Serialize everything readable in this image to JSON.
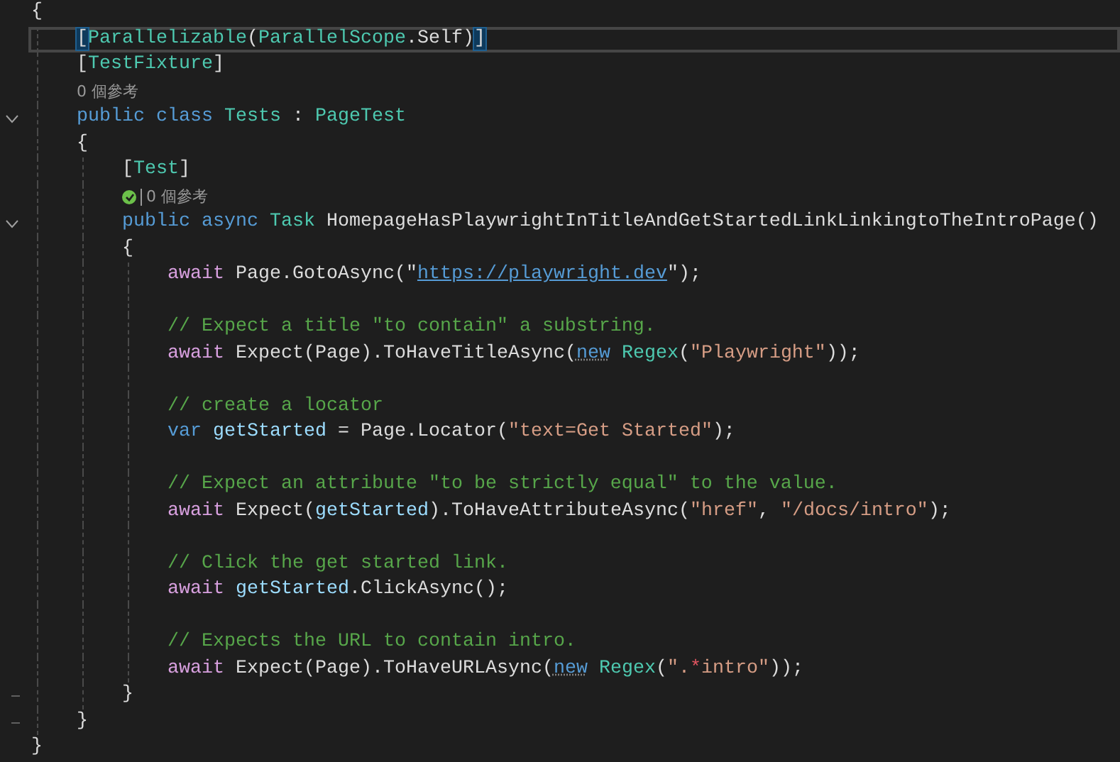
{
  "lines": [
    {
      "kind": "code",
      "tokens": [
        {
          "text": "{",
          "kind": "plain"
        }
      ],
      "children": [
        {
          "kind": "code",
          "current": true,
          "tokens": [
            {
              "text": "[",
              "kind": "plain",
              "match": true
            },
            {
              "text": "Parallelizable",
              "kind": "type"
            },
            {
              "text": "(",
              "kind": "plain"
            },
            {
              "text": "ParallelScope",
              "kind": "type"
            },
            {
              "text": ".Self)",
              "kind": "plain"
            },
            {
              "text": "]",
              "kind": "plain",
              "match": true
            }
          ]
        },
        {
          "kind": "code",
          "tokens": [
            {
              "text": "[",
              "kind": "plain"
            },
            {
              "text": "TestFixture",
              "kind": "type"
            },
            {
              "text": "]",
              "kind": "plain"
            }
          ]
        },
        {
          "kind": "codelens",
          "text": "0 個參考"
        },
        {
          "kind": "code",
          "foldable": true,
          "tokens": [
            {
              "text": "public class",
              "kind": "keyword"
            },
            {
              "text": " Tests",
              "kind": "type"
            },
            {
              "text": " : ",
              "kind": "plain"
            },
            {
              "text": "PageTest",
              "kind": "type"
            }
          ]
        },
        {
          "kind": "code",
          "tokens": [
            {
              "text": "{",
              "kind": "plain"
            }
          ],
          "children": [
            {
              "kind": "code",
              "tokens": [
                {
                  "text": "[",
                  "kind": "plain"
                },
                {
                  "text": "Test",
                  "kind": "type"
                },
                {
                  "text": "]",
                  "kind": "plain"
                }
              ]
            },
            {
              "kind": "codelens",
              "passed": true,
              "text": "0 個參考"
            },
            {
              "kind": "code",
              "foldable": true,
              "tokens": [
                {
                  "text": "public async",
                  "kind": "keyword"
                },
                {
                  "text": " Task",
                  "kind": "type"
                },
                {
                  "text": " HomepageHasPlaywrightInTitleAndGetStartedLinkLinkingtoTheIntroPage()",
                  "kind": "plain"
                }
              ]
            },
            {
              "kind": "code",
              "tokens": [
                {
                  "text": "{",
                  "kind": "plain"
                }
              ],
              "children": [
                {
                  "kind": "code",
                  "tokens": [
                    {
                      "text": "await",
                      "kind": "control"
                    },
                    {
                      "text": " Page.GotoAsync(\"",
                      "kind": "plain"
                    },
                    {
                      "text": "https://playwright.dev",
                      "kind": "link"
                    },
                    {
                      "text": "\");",
                      "kind": "plain"
                    }
                  ]
                },
                {
                  "kind": "blank"
                },
                {
                  "kind": "code",
                  "tokens": [
                    {
                      "text": "// Expect a title \"to contain\" a substring.",
                      "kind": "comment"
                    }
                  ]
                },
                {
                  "kind": "code",
                  "tokens": [
                    {
                      "text": "await",
                      "kind": "control"
                    },
                    {
                      "text": " Expect(Page).ToHaveTitleAsync(",
                      "kind": "plain"
                    },
                    {
                      "text": "new",
                      "kind": "keyword",
                      "hint": true
                    },
                    {
                      "text": " Regex",
                      "kind": "type"
                    },
                    {
                      "text": "(",
                      "kind": "plain"
                    },
                    {
                      "text": "\"Playwright\"",
                      "kind": "string"
                    },
                    {
                      "text": "));",
                      "kind": "plain"
                    }
                  ]
                },
                {
                  "kind": "blank"
                },
                {
                  "kind": "code",
                  "tokens": [
                    {
                      "text": "// create a locator",
                      "kind": "comment"
                    }
                  ]
                },
                {
                  "kind": "code",
                  "tokens": [
                    {
                      "text": "var",
                      "kind": "keyword"
                    },
                    {
                      "text": " getStarted",
                      "kind": "variable"
                    },
                    {
                      "text": " = Page.Locator(",
                      "kind": "plain"
                    },
                    {
                      "text": "\"text=Get Started\"",
                      "kind": "string"
                    },
                    {
                      "text": ");",
                      "kind": "plain"
                    }
                  ]
                },
                {
                  "kind": "blank"
                },
                {
                  "kind": "code",
                  "tokens": [
                    {
                      "text": "// Expect an attribute \"to be strictly equal\" to the value.",
                      "kind": "comment"
                    }
                  ]
                },
                {
                  "kind": "code",
                  "tokens": [
                    {
                      "text": "await",
                      "kind": "control"
                    },
                    {
                      "text": " Expect(",
                      "kind": "plain"
                    },
                    {
                      "text": "getStarted",
                      "kind": "variable"
                    },
                    {
                      "text": ").ToHaveAttributeAsync(",
                      "kind": "plain"
                    },
                    {
                      "text": "\"href\"",
                      "kind": "string"
                    },
                    {
                      "text": ", ",
                      "kind": "plain"
                    },
                    {
                      "text": "\"/docs/intro\"",
                      "kind": "string"
                    },
                    {
                      "text": ");",
                      "kind": "plain"
                    }
                  ]
                },
                {
                  "kind": "blank"
                },
                {
                  "kind": "code",
                  "tokens": [
                    {
                      "text": "// Click the get started link.",
                      "kind": "comment"
                    }
                  ]
                },
                {
                  "kind": "code",
                  "tokens": [
                    {
                      "text": "await",
                      "kind": "control"
                    },
                    {
                      "text": " getStarted",
                      "kind": "variable"
                    },
                    {
                      "text": ".ClickAsync();",
                      "kind": "plain"
                    }
                  ]
                },
                {
                  "kind": "blank"
                },
                {
                  "kind": "code",
                  "tokens": [
                    {
                      "text": "// Expects the URL to contain intro.",
                      "kind": "comment"
                    }
                  ]
                },
                {
                  "kind": "code",
                  "tokens": [
                    {
                      "text": "await",
                      "kind": "control"
                    },
                    {
                      "text": " Expect(Page).ToHaveURLAsync(",
                      "kind": "plain"
                    },
                    {
                      "text": "new",
                      "kind": "keyword",
                      "hint": true
                    },
                    {
                      "text": " Regex",
                      "kind": "type"
                    },
                    {
                      "text": "(",
                      "kind": "plain"
                    },
                    {
                      "text": "\".",
                      "kind": "string"
                    },
                    {
                      "text": "*",
                      "kind": "escape"
                    },
                    {
                      "text": "intro\"",
                      "kind": "string"
                    },
                    {
                      "text": "));",
                      "kind": "plain"
                    }
                  ]
                }
              ]
            },
            {
              "kind": "code",
              "fold_end": true,
              "tokens": [
                {
                  "text": "}",
                  "kind": "plain"
                }
              ]
            }
          ]
        },
        {
          "kind": "code",
          "fold_end": true,
          "tokens": [
            {
              "text": "}",
              "kind": "plain"
            }
          ]
        }
      ]
    },
    {
      "kind": "code",
      "tokens": [
        {
          "text": "}",
          "kind": "plain"
        }
      ]
    }
  ]
}
